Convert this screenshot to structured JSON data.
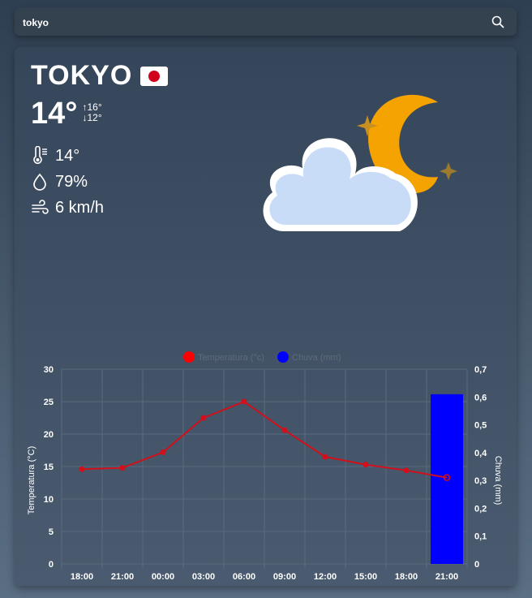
{
  "search": {
    "value": "tokyo",
    "icon": "search-icon"
  },
  "weather": {
    "city": "TOKYO",
    "temperature": "14°",
    "max": "↑16°",
    "min": "↓12°",
    "feels_like": "14°",
    "humidity": "79%",
    "wind": "6 km/h"
  },
  "colors": {
    "temp_line": "#d0101a",
    "rain_bar": "#0000ff",
    "moon": "#f5a300",
    "cloud": "#c8dcf8"
  },
  "chart_data": {
    "type": "bar",
    "categories": [
      "18:00",
      "21:00",
      "00:00",
      "03:00",
      "06:00",
      "09:00",
      "12:00",
      "15:00",
      "18:00",
      "21:00"
    ],
    "series": [
      {
        "name": "Temperatura (°c)",
        "type": "line",
        "axis": "left",
        "values": [
          14.6,
          14.8,
          17.2,
          22.5,
          25.0,
          20.6,
          16.5,
          15.3,
          14.4,
          13.3
        ]
      },
      {
        "name": "Chuva (mm)",
        "type": "bar",
        "axis": "right",
        "values": [
          0,
          0,
          0,
          0,
          0,
          0,
          0,
          0,
          0,
          0.61
        ]
      }
    ],
    "ylabel": "Temperatura (°C)",
    "y2label": "Chuva (mm)",
    "ylim": [
      0,
      30
    ],
    "y2lim": [
      0,
      0.7
    ],
    "yticks": [
      "0",
      "5",
      "10",
      "15",
      "20",
      "25",
      "30"
    ],
    "y2ticks": [
      "0",
      "0,1",
      "0,2",
      "0,3",
      "0,4",
      "0,5",
      "0,6",
      "0,7"
    ],
    "grid": true,
    "legend": "top-center"
  }
}
